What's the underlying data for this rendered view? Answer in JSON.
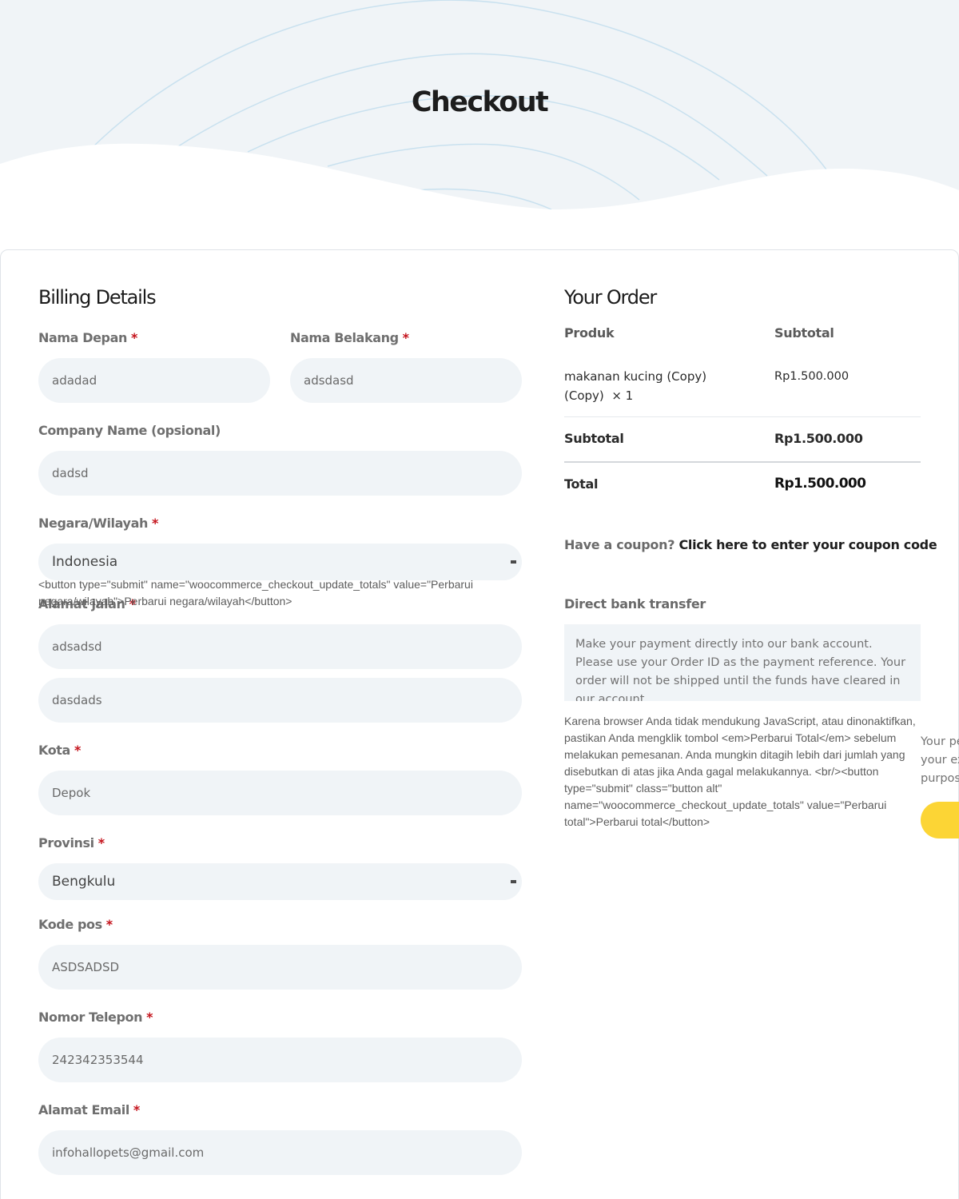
{
  "page": {
    "title": "Checkout"
  },
  "billing": {
    "heading": "Billing Details",
    "required_mark": "*",
    "first_name": {
      "label": "Nama Depan",
      "value": "adadad"
    },
    "last_name": {
      "label": "Nama Belakang",
      "value": "adsdasd"
    },
    "company": {
      "label": "Company Name (opsional)",
      "value": "dadsd"
    },
    "country": {
      "label": "Negara/Wilayah",
      "value": "Indonesia"
    },
    "country_update_raw": "<button type=\"submit\" name=\"woocommerce_checkout_update_totals\" value=\"Perbarui negara/wilayah\">Perbarui negara/wilayah</button>",
    "street": {
      "label": "Alamat jalan",
      "value": "adsadsd",
      "value2": "dasdads"
    },
    "city": {
      "label": "Kota",
      "value": "Depok"
    },
    "province": {
      "label": "Provinsi",
      "value": "Bengkulu"
    },
    "postcode": {
      "label": "Kode pos",
      "value": "ASDSADSD"
    },
    "phone": {
      "label": "Nomor Telepon",
      "value": "242342353544"
    },
    "email": {
      "label": "Alamat Email",
      "value": "infohallopets@gmail.com"
    }
  },
  "order": {
    "heading": "Your Order",
    "col_product": "Produk",
    "col_subtotal": "Subtotal",
    "items": [
      {
        "name_line1": "makanan kucing (Copy)",
        "name_line2": "(Copy)",
        "qty": "× 1",
        "subtotal": "Rp1.500.000"
      }
    ],
    "subtotal_label": "Subtotal",
    "subtotal_value": "Rp1.500.000",
    "total_label": "Total",
    "total_value": "Rp1.500.000"
  },
  "coupon": {
    "prompt": "Have a coupon?",
    "link": "Click here to enter your coupon code"
  },
  "payment": {
    "method": "Direct bank transfer",
    "description": "Make your payment directly into our bank account. Please use your Order ID as the payment reference. Your order will not be shipped until the funds have cleared in our account.",
    "noscript_notice": "Karena browser Anda tidak mendukung JavaScript, atau dinonaktifkan, pastikan Anda mengklik tombol <em>Perbarui Total</em> sebelum melakukan pemesanan. Anda mungkin ditagih lebih dari jumlah yang disebutkan di atas jika Anda gagal melakukannya. <br/><button type=\"submit\" class=\"button alt\" name=\"woocommerce_checkout_update_totals\" value=\"Perbarui total\">Perbarui total</button>",
    "privacy_lines": [
      "Your pe",
      "your ex",
      "purpos"
    ]
  },
  "colors": {
    "accent": "#fcd535",
    "field_bg": "#f0f4f7",
    "required": "#c4121b"
  }
}
